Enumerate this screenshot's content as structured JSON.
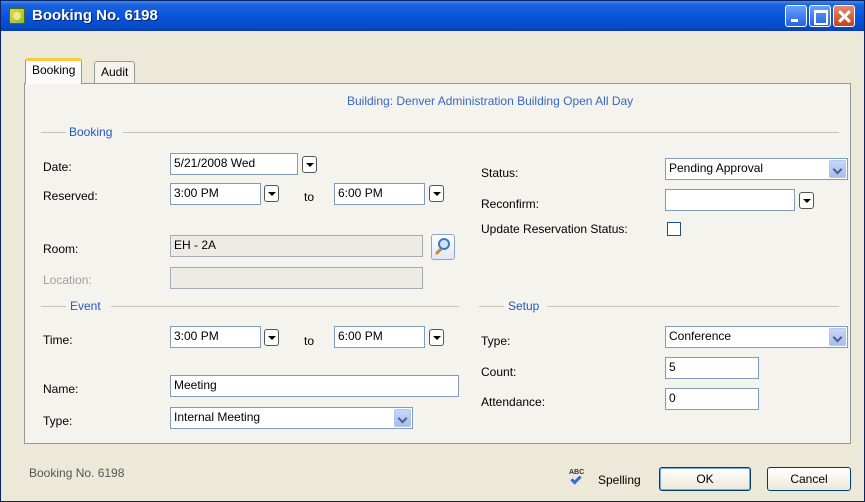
{
  "window": {
    "title": "Booking No. 6198"
  },
  "tabs": [
    {
      "label": "Booking",
      "active": true
    },
    {
      "label": "Audit",
      "active": false
    }
  ],
  "building_info": "Building: Denver Administration Building  Open All Day",
  "booking": {
    "section_title": "Booking",
    "date_label": "Date:",
    "date_value": "5/21/2008 Wed",
    "reserved_label": "Reserved:",
    "reserved_from": "3:00 PM",
    "to_label": "to",
    "reserved_to": "6:00 PM",
    "room_label": "Room:",
    "room_value": "EH - 2A",
    "location_label": "Location:",
    "location_value": "",
    "status_label": "Status:",
    "status_value": "Pending Approval",
    "reconfirm_label": "Reconfirm:",
    "reconfirm_value": "",
    "update_status_label": "Update Reservation Status:",
    "update_status_checked": false
  },
  "event": {
    "section_title": "Event",
    "time_label": "Time:",
    "time_from": "3:00 PM",
    "to_label": "to",
    "time_to": "6:00 PM",
    "name_label": "Name:",
    "name_value": "Meeting",
    "type_label": "Type:",
    "type_value": "Internal Meeting"
  },
  "setup": {
    "section_title": "Setup",
    "type_label": "Type:",
    "type_value": "Conference",
    "count_label": "Count:",
    "count_value": "5",
    "attendance_label": "Attendance:",
    "attendance_value": "0"
  },
  "footer": {
    "status_text": "Booking No. 6198",
    "spelling_label": "Spelling",
    "ok_label": "OK",
    "cancel_label": "Cancel"
  },
  "colors": {
    "titlebar": "#0855dd",
    "accent_text": "#3468c8",
    "section_title": "#2357c2",
    "active_tab_highlight": "#ffc83c"
  }
}
